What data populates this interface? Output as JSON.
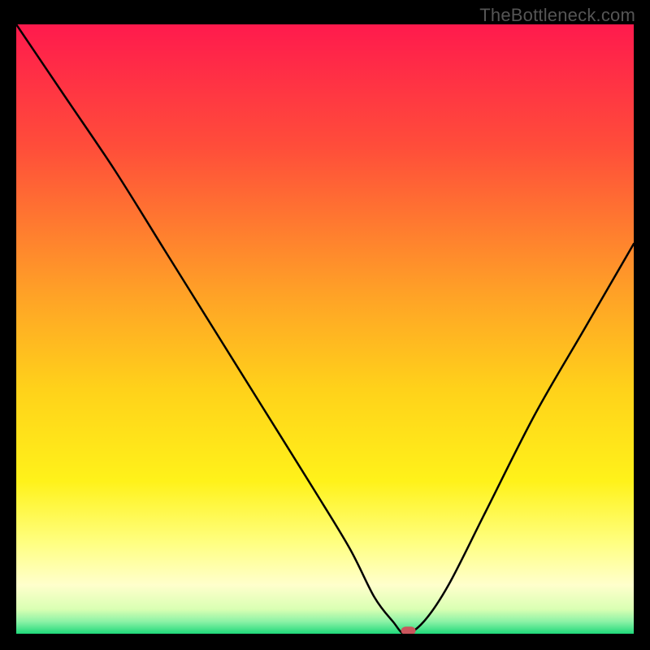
{
  "watermark": "TheBottleneck.com",
  "chart_data": {
    "type": "line",
    "title": "",
    "xlabel": "",
    "ylabel": "",
    "xlim": [
      0,
      100
    ],
    "ylim": [
      0,
      100
    ],
    "gradient_stops": [
      {
        "offset": 0,
        "color": "#ff1a4d"
      },
      {
        "offset": 20,
        "color": "#ff4d3a"
      },
      {
        "offset": 45,
        "color": "#ffa426"
      },
      {
        "offset": 60,
        "color": "#ffd21a"
      },
      {
        "offset": 75,
        "color": "#fff21a"
      },
      {
        "offset": 85,
        "color": "#ffff80"
      },
      {
        "offset": 92,
        "color": "#ffffcc"
      },
      {
        "offset": 96,
        "color": "#d9ffb3"
      },
      {
        "offset": 98,
        "color": "#8cf2a6"
      },
      {
        "offset": 100,
        "color": "#1fd97a"
      }
    ],
    "curve": {
      "x": [
        0,
        8,
        16,
        24,
        32,
        40,
        48,
        54,
        58,
        61,
        63,
        66,
        70,
        76,
        84,
        92,
        100
      ],
      "y": [
        100,
        88,
        76,
        63,
        50,
        37,
        24,
        14,
        6,
        2,
        0,
        2,
        8,
        20,
        36,
        50,
        64
      ]
    },
    "marker": {
      "x": 63.5,
      "y": 0.5,
      "color": "#c9555c"
    }
  }
}
